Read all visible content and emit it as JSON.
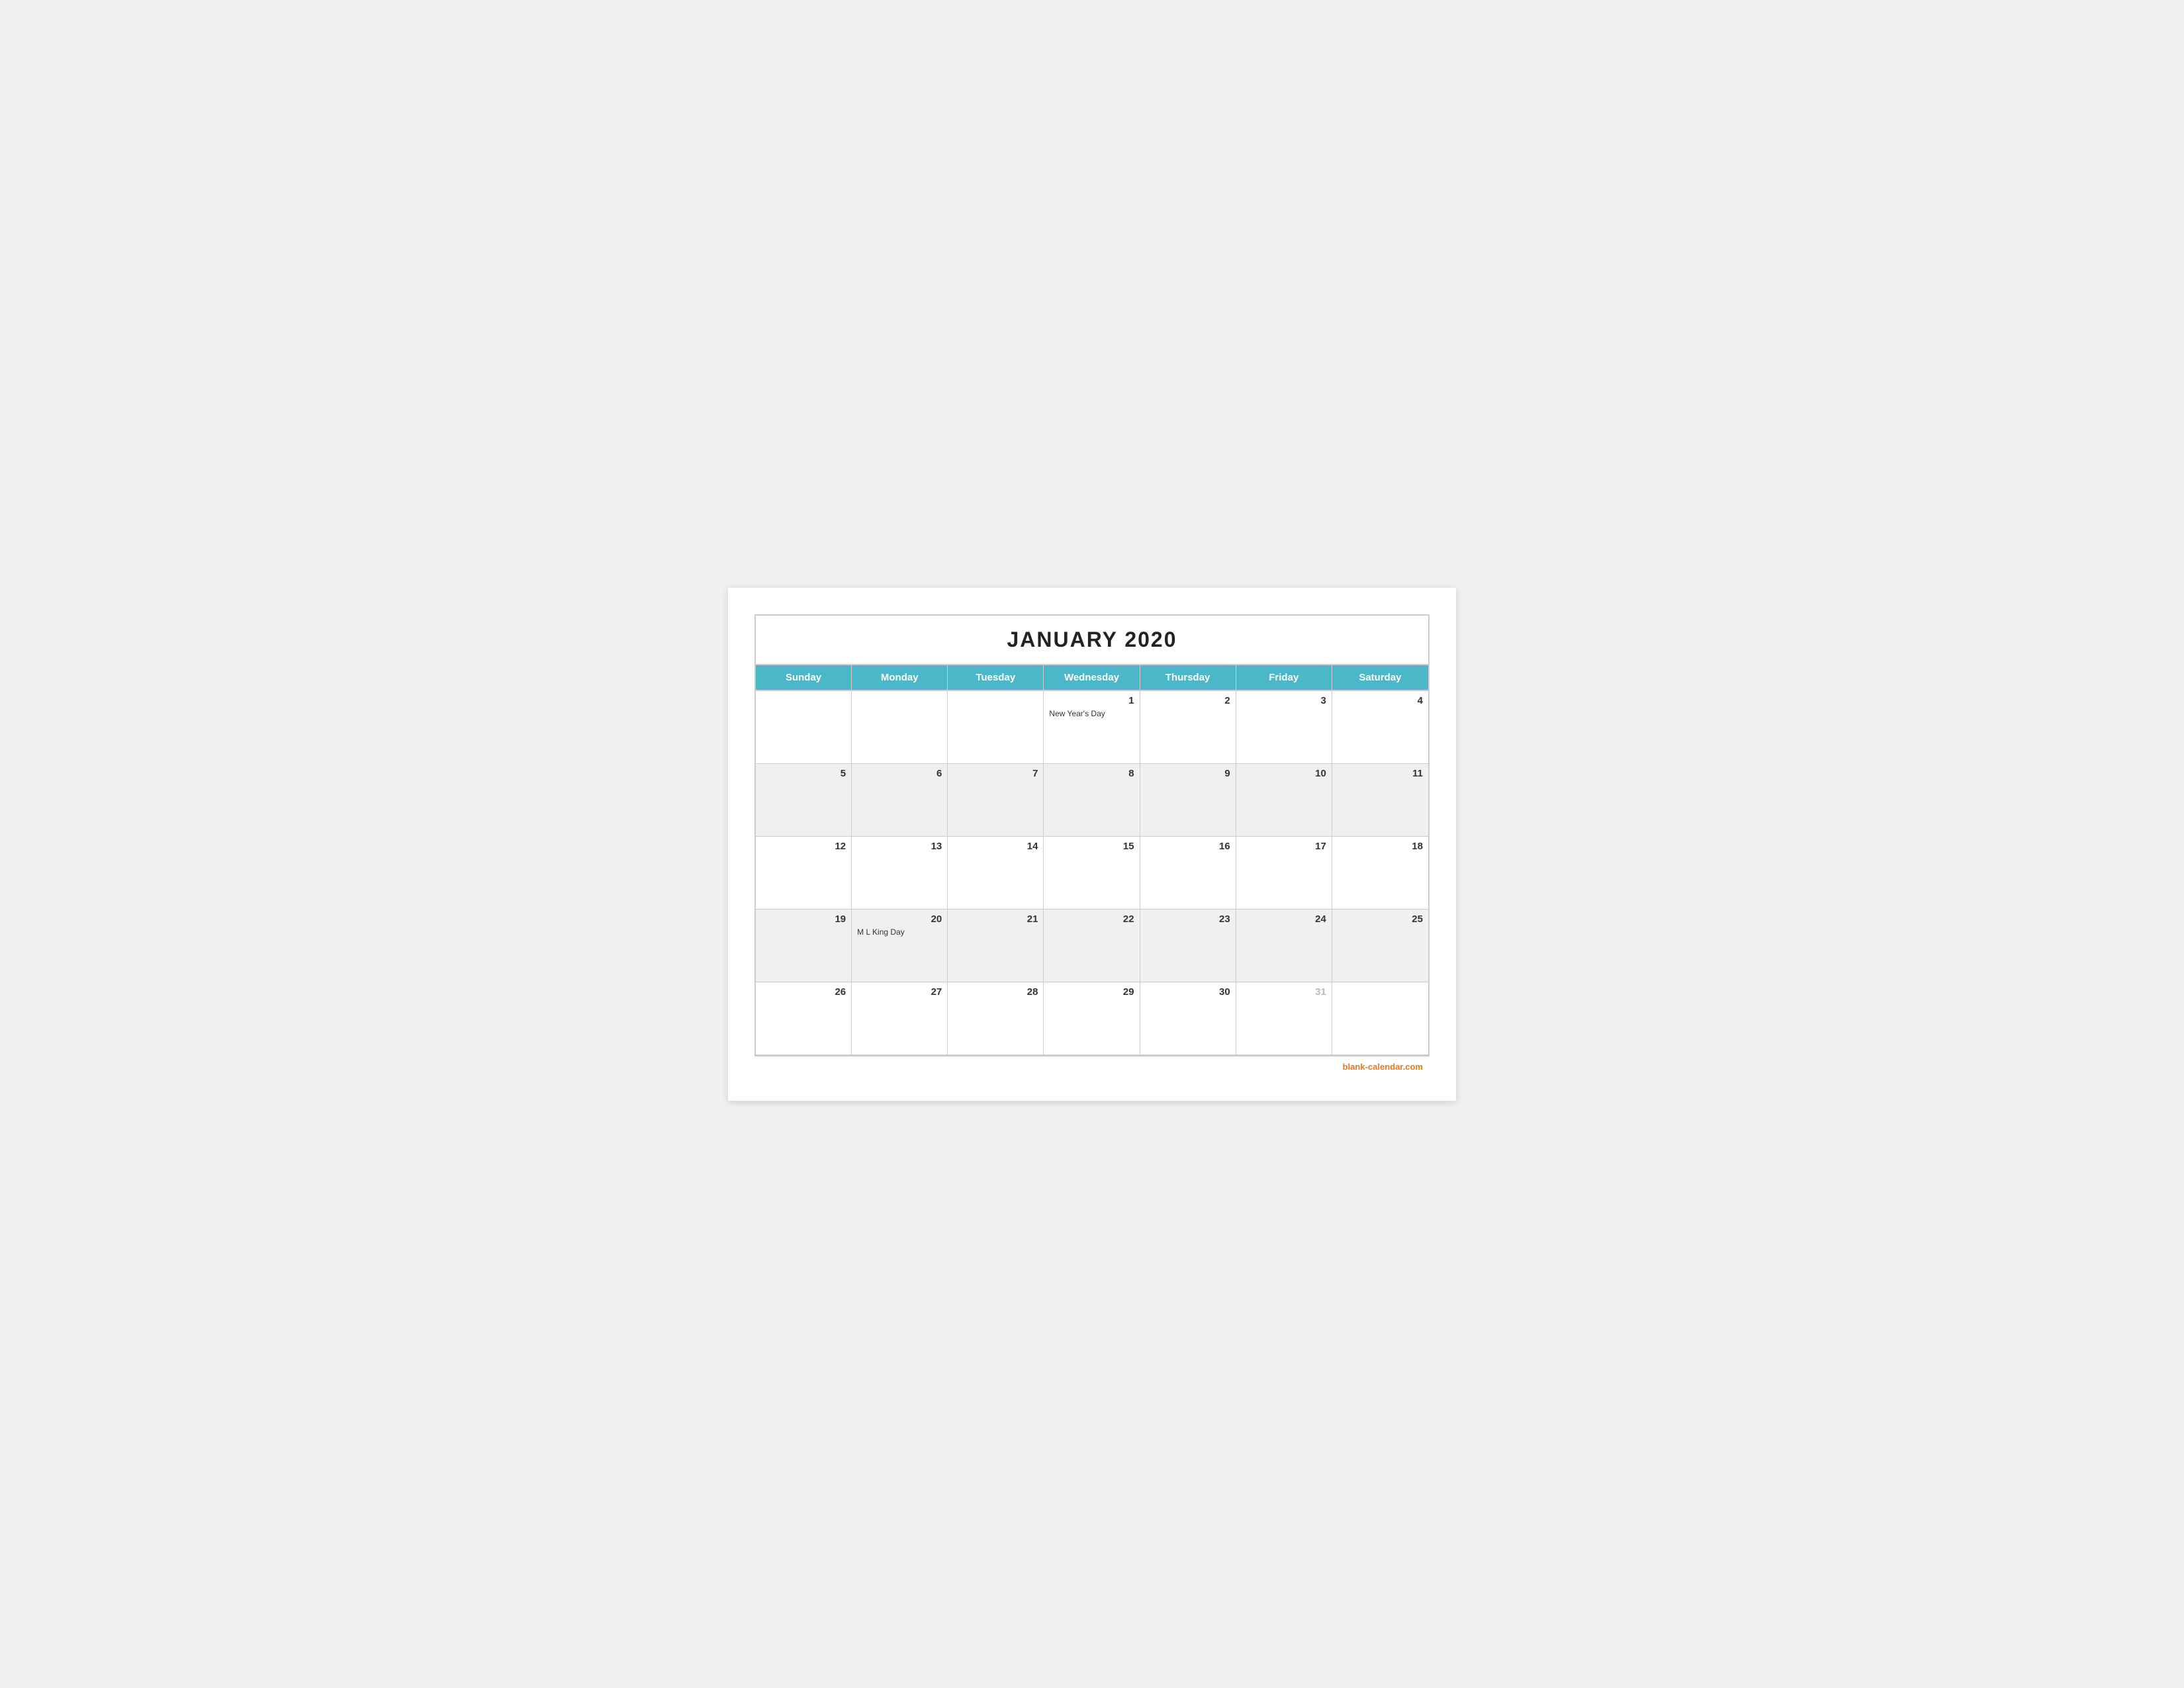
{
  "calendar": {
    "title": "JANUARY 2020",
    "headers": [
      "Sunday",
      "Monday",
      "Tuesday",
      "Wednesday",
      "Thursday",
      "Friday",
      "Saturday"
    ],
    "footer_text": "blank-calendar.com",
    "footer_url": "blank-calendar.com",
    "rows": [
      [
        {
          "date": "",
          "event": "",
          "empty": true,
          "shaded": false
        },
        {
          "date": "",
          "event": "",
          "empty": true,
          "shaded": false
        },
        {
          "date": "",
          "event": "",
          "empty": true,
          "shaded": false
        },
        {
          "date": "1",
          "event": "New Year's Day",
          "empty": false,
          "shaded": false
        },
        {
          "date": "2",
          "event": "",
          "empty": false,
          "shaded": false
        },
        {
          "date": "3",
          "event": "",
          "empty": false,
          "shaded": false
        },
        {
          "date": "4",
          "event": "",
          "empty": false,
          "shaded": false
        }
      ],
      [
        {
          "date": "5",
          "event": "",
          "empty": false,
          "shaded": true
        },
        {
          "date": "6",
          "event": "",
          "empty": false,
          "shaded": true
        },
        {
          "date": "7",
          "event": "",
          "empty": false,
          "shaded": true
        },
        {
          "date": "8",
          "event": "",
          "empty": false,
          "shaded": true
        },
        {
          "date": "9",
          "event": "",
          "empty": false,
          "shaded": true
        },
        {
          "date": "10",
          "event": "",
          "empty": false,
          "shaded": true
        },
        {
          "date": "11",
          "event": "",
          "empty": false,
          "shaded": true
        }
      ],
      [
        {
          "date": "12",
          "event": "",
          "empty": false,
          "shaded": false
        },
        {
          "date": "13",
          "event": "",
          "empty": false,
          "shaded": false
        },
        {
          "date": "14",
          "event": "",
          "empty": false,
          "shaded": false
        },
        {
          "date": "15",
          "event": "",
          "empty": false,
          "shaded": false
        },
        {
          "date": "16",
          "event": "",
          "empty": false,
          "shaded": false
        },
        {
          "date": "17",
          "event": "",
          "empty": false,
          "shaded": false
        },
        {
          "date": "18",
          "event": "",
          "empty": false,
          "shaded": false
        }
      ],
      [
        {
          "date": "19",
          "event": "",
          "empty": false,
          "shaded": true
        },
        {
          "date": "20",
          "event": "M L King Day",
          "empty": false,
          "shaded": true
        },
        {
          "date": "21",
          "event": "",
          "empty": false,
          "shaded": true
        },
        {
          "date": "22",
          "event": "",
          "empty": false,
          "shaded": true
        },
        {
          "date": "23",
          "event": "",
          "empty": false,
          "shaded": true
        },
        {
          "date": "24",
          "event": "",
          "empty": false,
          "shaded": true
        },
        {
          "date": "25",
          "event": "",
          "empty": false,
          "shaded": true
        }
      ],
      [
        {
          "date": "26",
          "event": "",
          "empty": false,
          "shaded": false
        },
        {
          "date": "27",
          "event": "",
          "empty": false,
          "shaded": false
        },
        {
          "date": "28",
          "event": "",
          "empty": false,
          "shaded": false
        },
        {
          "date": "29",
          "event": "",
          "empty": false,
          "shaded": false
        },
        {
          "date": "30",
          "event": "",
          "empty": false,
          "shaded": false
        },
        {
          "date": "31",
          "event": "",
          "empty": false,
          "shaded": false,
          "muted": true
        },
        {
          "date": "",
          "event": "",
          "empty": true,
          "shaded": false
        }
      ]
    ]
  }
}
